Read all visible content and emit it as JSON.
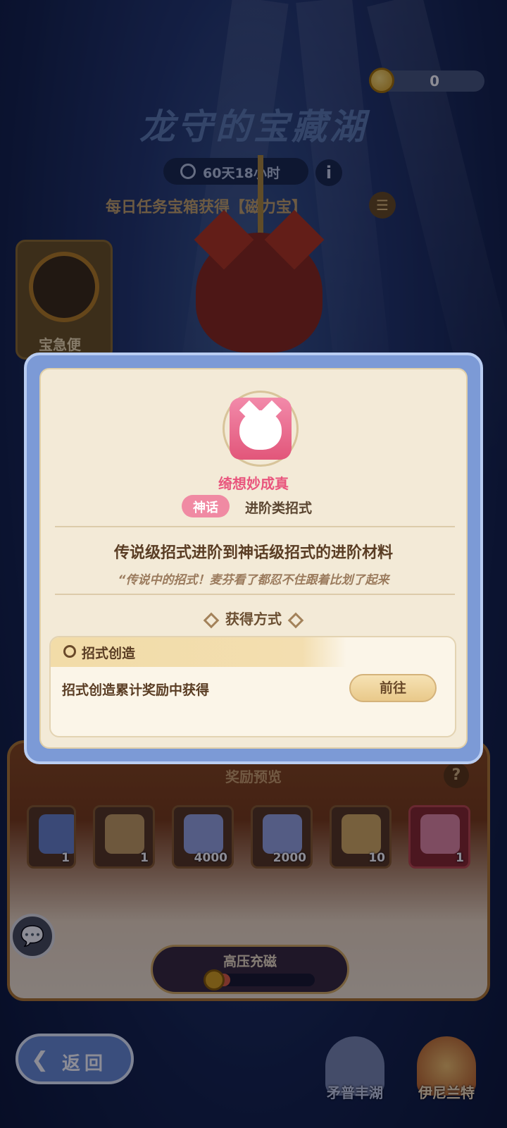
{
  "header": {
    "coin_count": "0",
    "title": "龙守的宝藏湖",
    "timer": "60天18小时",
    "info_label": "i",
    "subtitle": "每日任务宝箱获得【磁力宝】",
    "side_card_label": "宝急便"
  },
  "rewards": {
    "title": "奖励预览",
    "help_label": "?",
    "items": [
      {
        "icon": "scene-card-icon",
        "count": "1",
        "color": "#6a86c8"
      },
      {
        "icon": "treasure-chest-icon",
        "count": "1",
        "color": "#c9a060"
      },
      {
        "icon": "star-crystal-icon",
        "count": "4000",
        "color": "#9aa8e0"
      },
      {
        "icon": "star-crystal-icon",
        "count": "2000",
        "color": "#9aa8e0"
      },
      {
        "icon": "lyre-icon",
        "count": "10",
        "color": "#d9b060"
      },
      {
        "icon": "cat-badge-icon",
        "count": "1",
        "color": "#e68aa0"
      }
    ]
  },
  "charge": {
    "label": "高压充磁",
    "progress": 0.2
  },
  "nav": {
    "back_label": "返回",
    "items": [
      {
        "label": "矛普丰湖",
        "active": false
      },
      {
        "label": "伊尼兰特",
        "active": true
      }
    ]
  },
  "modal": {
    "item_name": "绮想妙成真",
    "rarity": "神话",
    "category": "进阶类招式",
    "description": "传说级招式进阶到神话级招式的进阶材料",
    "quote": "“传说中的招式！麦芬看了都忍不住跟着比划了起来",
    "obtain_title": "获得方式",
    "source": {
      "title": "招式创造",
      "text": "招式创造累计奖励中获得",
      "button": "前往"
    }
  },
  "colors": {
    "modal_frame": "#7c9ad6",
    "rarity_pink": "#f08aa3",
    "item_name": "#e9557d",
    "panel_bg": "#f3ead7"
  }
}
